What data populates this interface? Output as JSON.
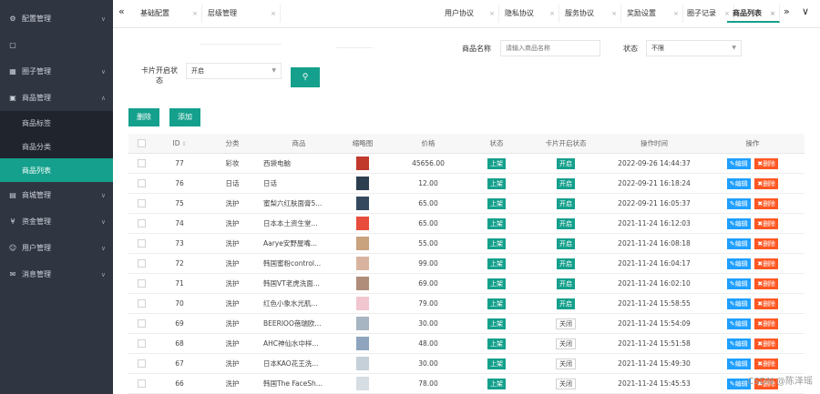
{
  "sidebar": {
    "items": [
      {
        "label": "配置管理",
        "icon": "gear-icon",
        "expanded": false
      },
      {
        "label": "",
        "icon": "file-icon",
        "expanded": false
      },
      {
        "label": "圈子管理",
        "icon": "grid-icon",
        "expanded": false
      },
      {
        "label": "商品管理",
        "icon": "box-icon",
        "expanded": true
      }
    ],
    "sub_items": [
      {
        "label": "商品标签"
      },
      {
        "label": "商品分类"
      },
      {
        "label": "商品列表",
        "active": true
      }
    ],
    "items_after": [
      {
        "label": "商城管理",
        "icon": "shop-icon"
      },
      {
        "label": "资金管理",
        "icon": "wallet-icon"
      },
      {
        "label": "用户管理",
        "icon": "user-icon"
      },
      {
        "label": "消息管理",
        "icon": "message-icon"
      }
    ]
  },
  "tabs": {
    "left": [
      "基础配置",
      "层级管理"
    ],
    "right": [
      "用户协议",
      "隐私协议",
      "服务协议",
      "奖励设置",
      "圈子记录",
      "商品列表"
    ],
    "active": "商品列表"
  },
  "filters": {
    "name_label": "商品名称",
    "name_placeholder": "请输入商品名称",
    "status_label": "状态",
    "status_value": "不限",
    "card_label": "卡片开启状态",
    "card_value": "开启"
  },
  "actions": {
    "delete": "删除",
    "add": "添加"
  },
  "table": {
    "headers": [
      "ID",
      "分类",
      "商品",
      "缩略图",
      "价格",
      "状态",
      "卡片开启状态",
      "操作时间",
      "操作"
    ],
    "edit_label": "编辑",
    "delete_label": "删除",
    "rows": [
      {
        "id": "77",
        "category": "彩妆",
        "product": "西袋电脑",
        "price": "45656.00",
        "status": "上架",
        "card": "开启",
        "time": "2022-09-26 14:44:37",
        "thumb": "#c0392b"
      },
      {
        "id": "76",
        "category": "日话",
        "product": "日话",
        "price": "12.00",
        "status": "上架",
        "card": "开启",
        "time": "2022-09-21 16:18:24",
        "thumb": "#2c3e50"
      },
      {
        "id": "75",
        "category": "洗护",
        "product": "蜜梨六红肤面膏5...",
        "price": "65.00",
        "status": "上架",
        "card": "开启",
        "time": "2022-09-21 16:05:37",
        "thumb": "#34495e"
      },
      {
        "id": "74",
        "category": "洗护",
        "product": "日本本土资生堂...",
        "price": "65.00",
        "status": "上架",
        "card": "开启",
        "time": "2021-11-24 16:12:03",
        "thumb": "#e74c3c"
      },
      {
        "id": "73",
        "category": "洗护",
        "product": "Aarye安野屋嘴...",
        "price": "55.00",
        "status": "上架",
        "card": "开启",
        "time": "2021-11-24 16:08:18",
        "thumb": "#c9a27e"
      },
      {
        "id": "72",
        "category": "洗护",
        "product": "韩国蜜粉control...",
        "price": "99.00",
        "status": "上架",
        "card": "开启",
        "time": "2021-11-24 16:04:17",
        "thumb": "#d8b4a0"
      },
      {
        "id": "71",
        "category": "洗护",
        "product": "韩国VT老虎洗面...",
        "price": "69.00",
        "status": "上架",
        "card": "开启",
        "time": "2021-11-24 16:02:10",
        "thumb": "#b08d7a"
      },
      {
        "id": "70",
        "category": "洗护",
        "product": "红色小象水光肌...",
        "price": "79.00",
        "status": "上架",
        "card": "开启",
        "time": "2021-11-24 15:58:55",
        "thumb": "#f1c6cf"
      },
      {
        "id": "69",
        "category": "洗护",
        "product": "BEERIOO蓓瑞欧...",
        "price": "30.00",
        "status": "上架",
        "card": "关闭",
        "time": "2021-11-24 15:54:09",
        "thumb": "#a7b4c2"
      },
      {
        "id": "68",
        "category": "洗护",
        "product": "AHC神仙水中样...",
        "price": "48.00",
        "status": "上架",
        "card": "关闭",
        "time": "2021-11-24 15:51:58",
        "thumb": "#8fa5bd"
      },
      {
        "id": "67",
        "category": "洗护",
        "product": "日本KAO花王洗...",
        "price": "30.00",
        "status": "上架",
        "card": "关闭",
        "time": "2021-11-24 15:49:30",
        "thumb": "#c5d0d9"
      },
      {
        "id": "66",
        "category": "洗护",
        "product": "韩国The FaceSh...",
        "price": "78.00",
        "status": "上架",
        "card": "关闭",
        "time": "2021-11-24 15:45:53",
        "thumb": "#d6dde3"
      }
    ]
  },
  "watermark": "CSDN @陈泽瑶"
}
